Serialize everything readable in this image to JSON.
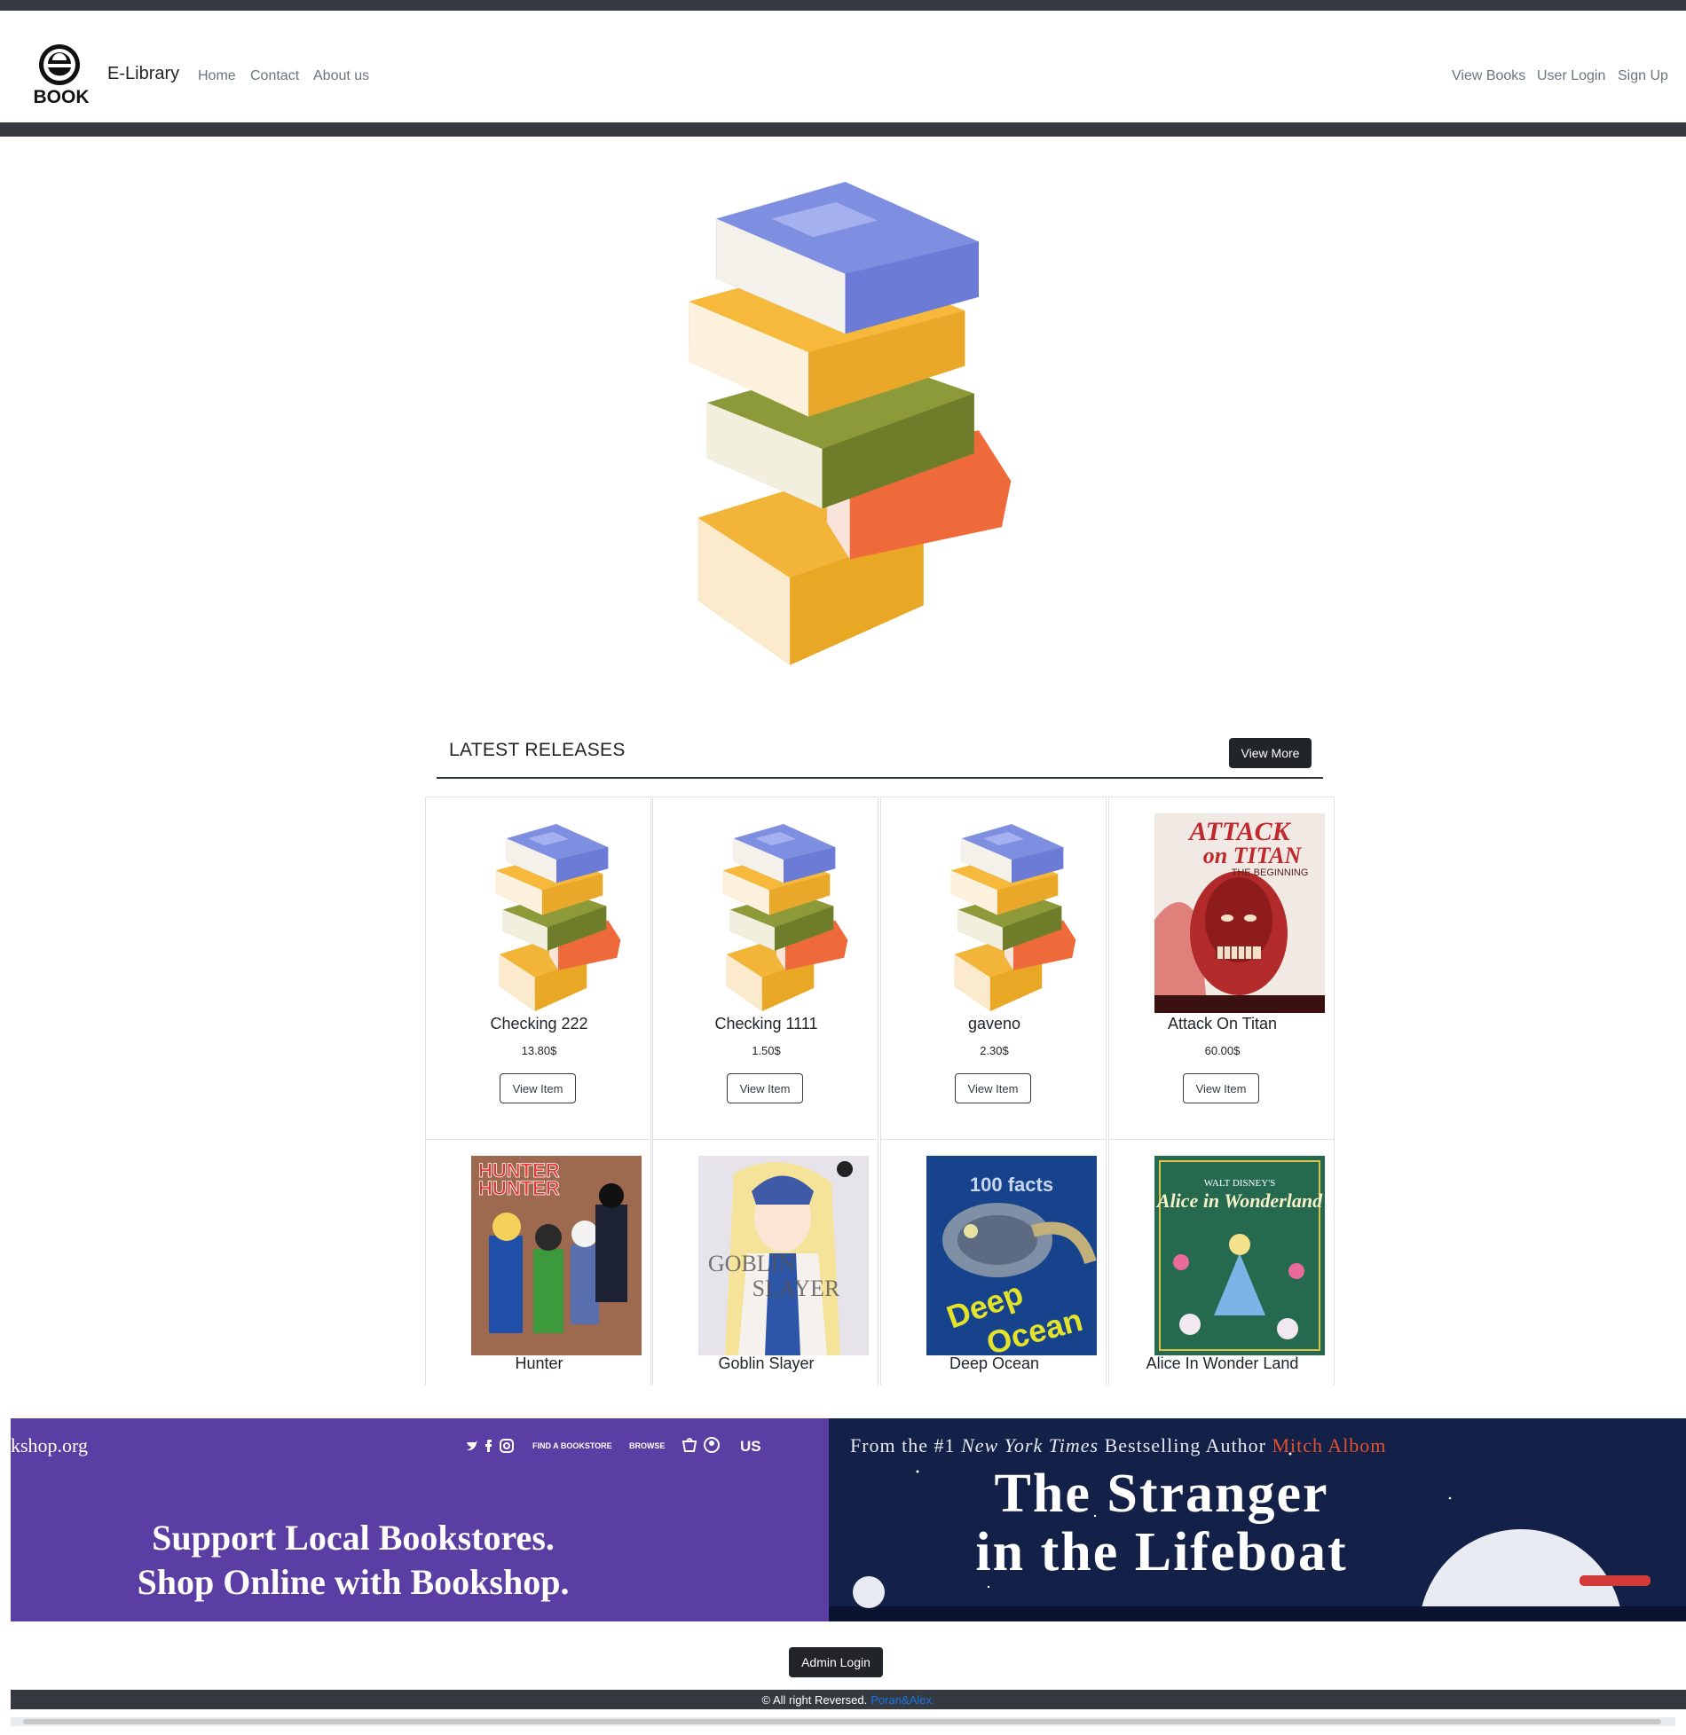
{
  "nav": {
    "logo_text": "BOOK",
    "brand": "E-Library",
    "links_left": [
      "Home",
      "Contact",
      "About us"
    ],
    "links_right": [
      "View Books",
      "User Login",
      "Sign Up"
    ]
  },
  "releases": {
    "title": "LATEST RELEASES",
    "view_more": "View More",
    "items": [
      {
        "title": "Checking 222",
        "price": "13.80$",
        "button": "View Item",
        "cover": "book-stack"
      },
      {
        "title": "Checking 1111",
        "price": "1.50$",
        "button": "View Item",
        "cover": "book-stack"
      },
      {
        "title": "gaveno",
        "price": "2.30$",
        "button": "View Item",
        "cover": "book-stack"
      },
      {
        "title": "Attack On Titan",
        "price": "60.00$",
        "button": "View Item",
        "cover": "attack-on-titan"
      },
      {
        "title": "Hunter",
        "cover": "hunter-x-hunter"
      },
      {
        "title": "Goblin Slayer",
        "cover": "goblin-slayer"
      },
      {
        "title": "Deep Ocean",
        "cover": "deep-ocean"
      },
      {
        "title": "Alice In Wonder Land",
        "cover": "alice-in-wonderland"
      }
    ]
  },
  "banner": {
    "left_site": "kshop.org",
    "left_nav": [
      "FIND A BOOKSTORE",
      "BROWSE"
    ],
    "left_region": "US",
    "left_line1": "Support Local Bookstores.",
    "left_line2": "Shop Online with Bookshop.",
    "right_tagline_a": "From the #1",
    "right_tagline_italic": "New York Times",
    "right_tagline_b": "Bestselling Author",
    "right_author": "Mitch Albom",
    "right_title1": "The Stranger",
    "right_title2": "in the Lifeboat"
  },
  "admin_login": "Admin Login",
  "footer": {
    "text": "© All right Reversed.",
    "link": "Poran&Alex."
  },
  "colors": {
    "dark": "#343a40",
    "banner_purple": "#5b3ea3",
    "banner_navy": "#132047",
    "link_blue": "#1a73e8"
  }
}
